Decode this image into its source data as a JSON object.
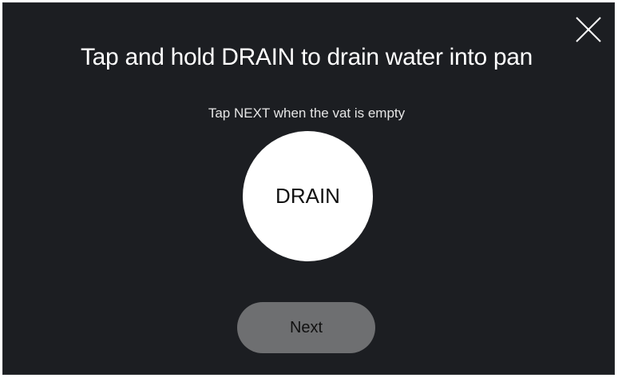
{
  "dialog": {
    "title": "Tap and hold DRAIN to drain water into pan",
    "subtitle": "Tap NEXT when the vat is empty",
    "drain_label": "DRAIN",
    "next_label": "Next",
    "close_icon": "close-icon"
  },
  "colors": {
    "background": "#1c1e22",
    "text": "#ffffff",
    "drain_button": "#ffffff",
    "next_button_disabled": "#6e6f71"
  }
}
